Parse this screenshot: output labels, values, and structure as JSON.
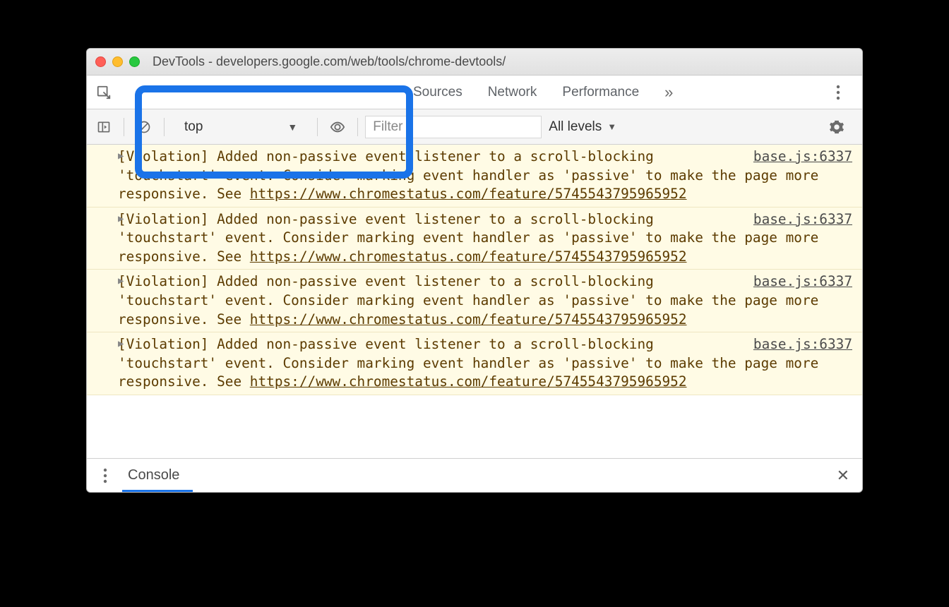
{
  "window": {
    "title": "DevTools - developers.google.com/web/tools/chrome-devtools/"
  },
  "tabs": {
    "sources": "Sources",
    "network": "Network",
    "performance": "Performance"
  },
  "toolbar": {
    "context": "top",
    "filter_placeholder": "Filter",
    "levels_label": "All levels"
  },
  "messages": [
    {
      "text_prefix": "[Violation] Added non-passive event listener to a scroll-blocking 'touchstart' event. Consider marking event handler as 'passive' to make the page more responsive. See ",
      "link_text": "https://www.chromestatus.com/feature/5745543795965952",
      "source": "base.js:6337"
    },
    {
      "text_prefix": "[Violation] Added non-passive event listener to a scroll-blocking 'touchstart' event. Consider marking event handler as 'passive' to make the page more responsive. See ",
      "link_text": "https://www.chromestatus.com/feature/5745543795965952",
      "source": "base.js:6337"
    },
    {
      "text_prefix": "[Violation] Added non-passive event listener to a scroll-blocking 'touchstart' event. Consider marking event handler as 'passive' to make the page more responsive. See ",
      "link_text": "https://www.chromestatus.com/feature/5745543795965952",
      "source": "base.js:6337"
    },
    {
      "text_prefix": "[Violation] Added non-passive event listener to a scroll-blocking 'touchstart' event. Consider marking event handler as 'passive' to make the page more responsive. See ",
      "link_text": "https://www.chromestatus.com/feature/5745543795965952",
      "source": "base.js:6337"
    }
  ],
  "drawer": {
    "label": "Console"
  }
}
